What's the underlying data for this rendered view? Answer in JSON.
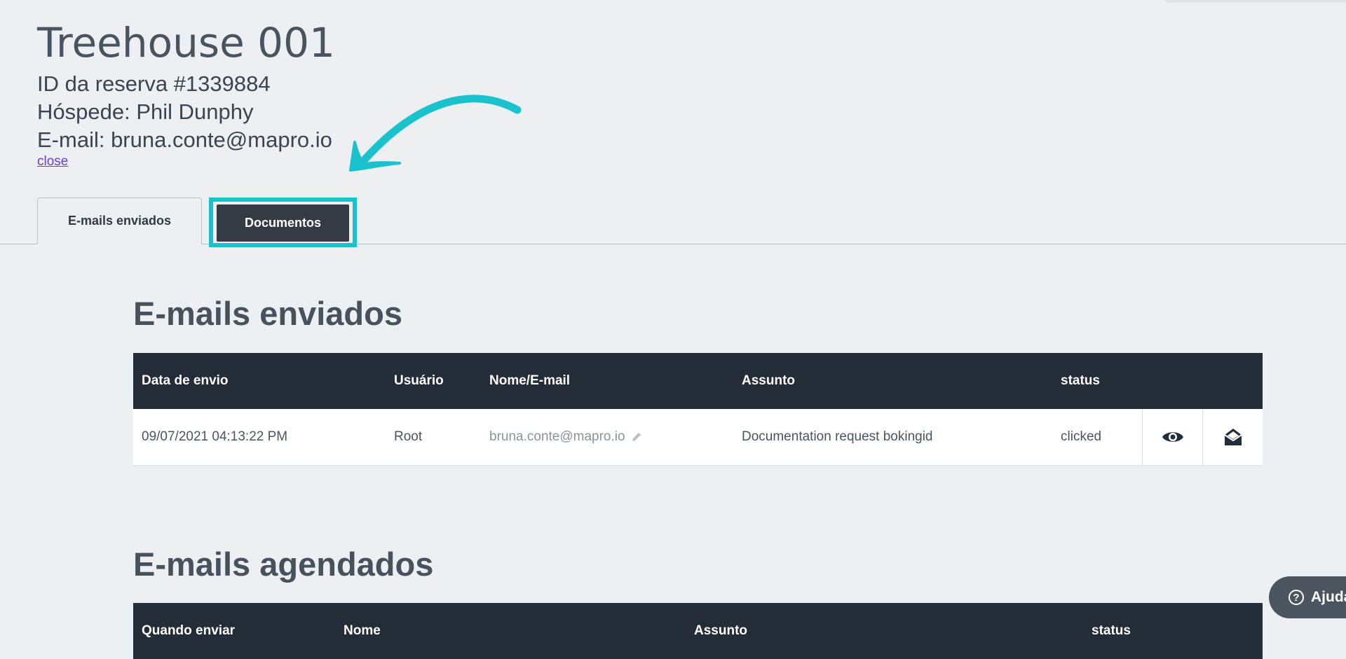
{
  "header": {
    "title": "Treehouse 001",
    "reservation_id": "ID da reserva #1339884",
    "guest": "Hóspede: Phil Dunphy",
    "email": "E-mail: bruna.conte@mapro.io",
    "close_label": "close"
  },
  "tabs": [
    {
      "label": "E-mails enviados"
    },
    {
      "label": "Documentos"
    }
  ],
  "sent_emails": {
    "title": "E-mails enviados",
    "columns": [
      "Data de envio",
      "Usuário",
      "Nome/E-mail",
      "Assunto",
      "status"
    ],
    "rows": [
      {
        "date": "09/07/2021 04:13:22 PM",
        "user": "Root",
        "email": "bruna.conte@mapro.io",
        "subject": "Documentation request bokingid",
        "status": "clicked"
      }
    ]
  },
  "scheduled_emails": {
    "title": "E-mails agendados",
    "columns": [
      "Quando enviar",
      "Nome",
      "Assunto",
      "status"
    ]
  },
  "help": {
    "icon_glyph": "?",
    "label": "Ajuda"
  },
  "colors": {
    "highlight": "#19c2cc",
    "table_header": "#232d37",
    "background": "#edf0f3",
    "active_tab": "#353b43"
  },
  "icons": [
    "pencil-icon",
    "eye-icon",
    "envelope-open-icon",
    "help-icon",
    "curved-arrow-icon"
  ]
}
